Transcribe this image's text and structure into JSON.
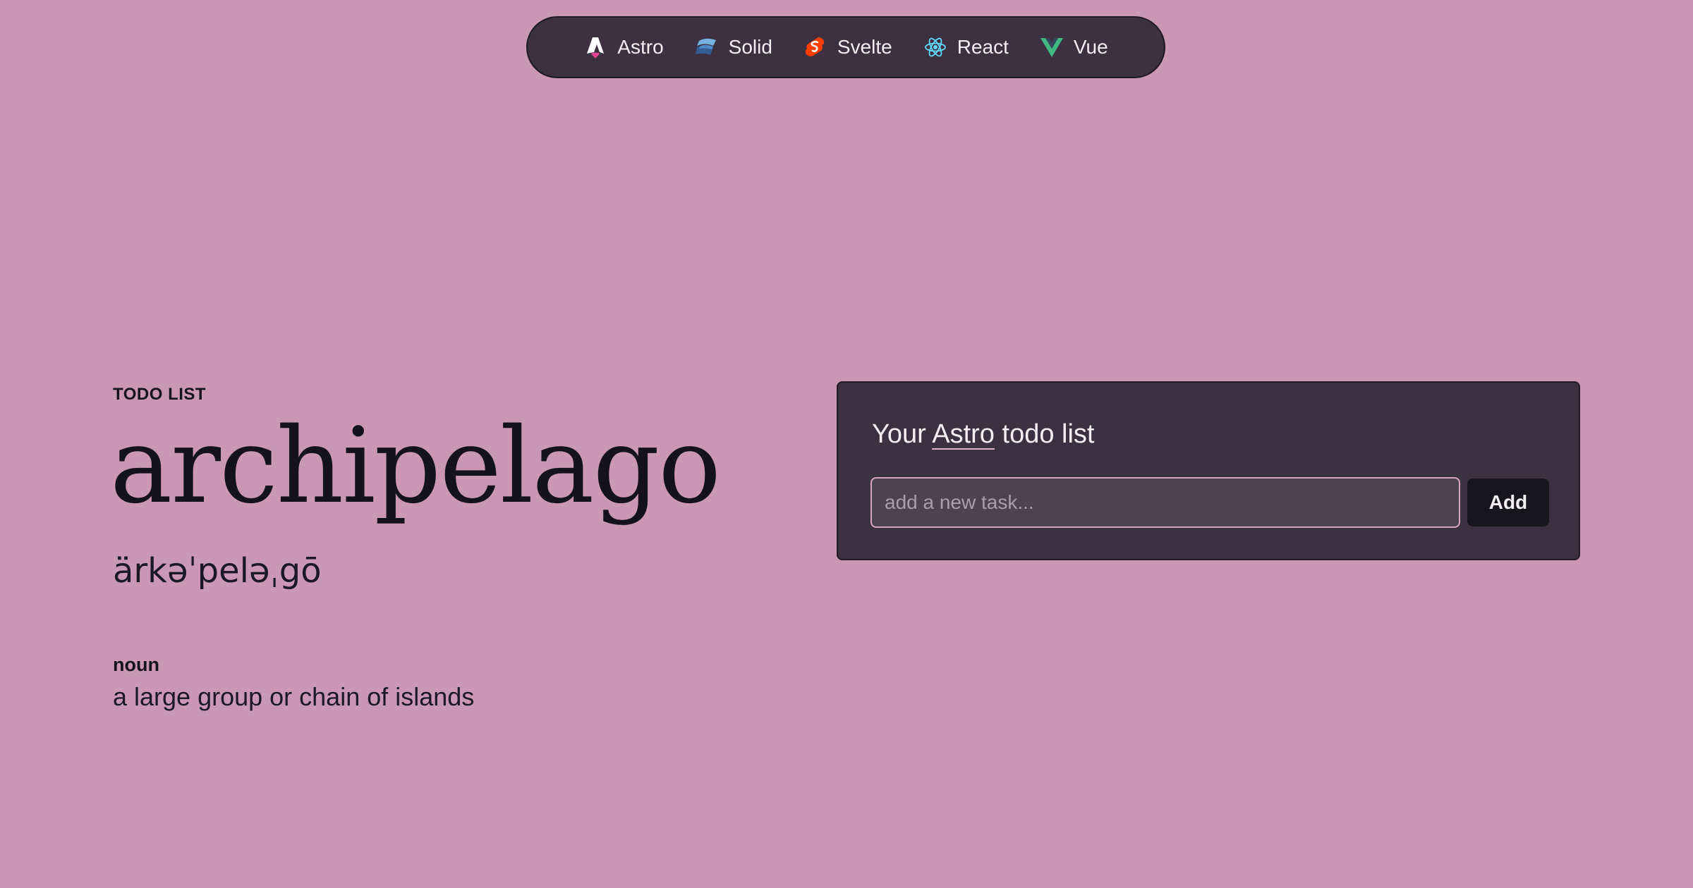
{
  "nav": {
    "items": [
      {
        "label": "Astro",
        "icon": "astro-logo-icon"
      },
      {
        "label": "Solid",
        "icon": "solid-logo-icon"
      },
      {
        "label": "Svelte",
        "icon": "svelte-logo-icon"
      },
      {
        "label": "React",
        "icon": "react-logo-icon"
      },
      {
        "label": "Vue",
        "icon": "vue-logo-icon"
      }
    ]
  },
  "definition": {
    "eyebrow": "TODO LIST",
    "word": "archipelago",
    "pronunciation": "ärkəˈpeləˌgō",
    "part_of_speech": "noun",
    "meaning": "a large group or chain of islands"
  },
  "todo": {
    "title_prefix": "Your",
    "framework": "Astro",
    "title_suffix": "todo list",
    "input_placeholder": "add a new task...",
    "input_value": "",
    "add_label": "Add"
  },
  "colors": {
    "page_background": "#cb97b6",
    "nav_background": "#3c3041",
    "card_background": "#3c3043",
    "input_border": "#d7a6c2",
    "button_background": "#17161f"
  }
}
